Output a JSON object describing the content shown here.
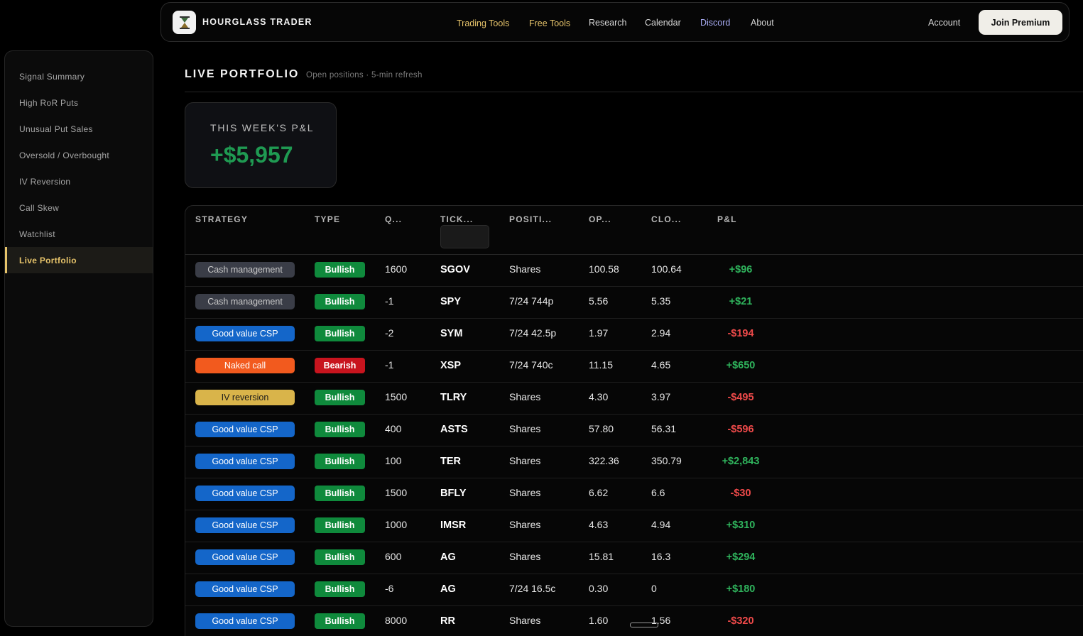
{
  "nav": {
    "brand": "HOURGLASS TRADER",
    "items": [
      "Trading Tools",
      "Free Tools",
      "Research",
      "Calendar",
      "Discord",
      "About"
    ],
    "account": "Account",
    "premium": "Join Premium"
  },
  "sidebar": {
    "items": [
      "Signal Summary",
      "High RoR Puts",
      "Unusual Put Sales",
      "Oversold / Overbought",
      "IV Reversion",
      "Call Skew",
      "Watchlist",
      "Live Portfolio"
    ],
    "active": "Live Portfolio"
  },
  "header": {
    "title": "LIVE PORTFOLIO",
    "subtitle": "Open positions · 5-min refresh"
  },
  "pnl_card": {
    "label": "THIS WEEK'S P&L",
    "value": "+$5,957"
  },
  "table": {
    "columns": [
      "STRATEGY",
      "TYPE",
      "Q...",
      "TICK...",
      "POSITI...",
      "OP...",
      "CLO...",
      "P&L"
    ],
    "rows": [
      {
        "strategy": "Cash management",
        "strategy_color": "#3a3d47",
        "type": "Bullish",
        "qty": "1600",
        "ticker": "SGOV",
        "position": "Shares",
        "open": "100.58",
        "close": "100.64",
        "pl": "+$96"
      },
      {
        "strategy": "Cash management",
        "strategy_color": "#3a3d47",
        "type": "Bullish",
        "qty": "-1",
        "ticker": "SPY",
        "position": "7/24 744p",
        "open": "5.56",
        "close": "5.35",
        "pl": "+$21"
      },
      {
        "strategy": "Good value CSP",
        "strategy_color": "#1466c9",
        "type": "Bullish",
        "qty": "-2",
        "ticker": "SYM",
        "position": "7/24 42.5p",
        "open": "1.97",
        "close": "2.94",
        "pl": "-$194"
      },
      {
        "strategy": "Naked call",
        "strategy_color": "#f25a1e",
        "type": "Bearish",
        "qty": "-1",
        "ticker": "XSP",
        "position": "7/24 740c",
        "open": "11.15",
        "close": "4.65",
        "pl": "+$650"
      },
      {
        "strategy": "IV reversion",
        "strategy_color": "#d9b44a",
        "type": "Bullish",
        "qty": "1500",
        "ticker": "TLRY",
        "position": "Shares",
        "open": "4.30",
        "close": "3.97",
        "pl": "-$495"
      },
      {
        "strategy": "Good value CSP",
        "strategy_color": "#1466c9",
        "type": "Bullish",
        "qty": "400",
        "ticker": "ASTS",
        "position": "Shares",
        "open": "57.80",
        "close": "56.31",
        "pl": "-$596"
      },
      {
        "strategy": "Good value CSP",
        "strategy_color": "#1466c9",
        "type": "Bullish",
        "qty": "100",
        "ticker": "TER",
        "position": "Shares",
        "open": "322.36",
        "close": "350.79",
        "pl": "+$2,843"
      },
      {
        "strategy": "Good value CSP",
        "strategy_color": "#1466c9",
        "type": "Bullish",
        "qty": "1500",
        "ticker": "BFLY",
        "position": "Shares",
        "open": "6.62",
        "close": "6.6",
        "pl": "-$30"
      },
      {
        "strategy": "Good value CSP",
        "strategy_color": "#1466c9",
        "type": "Bullish",
        "qty": "1000",
        "ticker": "IMSR",
        "position": "Shares",
        "open": "4.63",
        "close": "4.94",
        "pl": "+$310"
      },
      {
        "strategy": "Good value CSP",
        "strategy_color": "#1466c9",
        "type": "Bullish",
        "qty": "600",
        "ticker": "AG",
        "position": "Shares",
        "open": "15.81",
        "close": "16.3",
        "pl": "+$294"
      },
      {
        "strategy": "Good value CSP",
        "strategy_color": "#1466c9",
        "type": "Bullish",
        "qty": "-6",
        "ticker": "AG",
        "position": "7/24 16.5c",
        "open": "0.30",
        "close": "0",
        "pl": "+$180"
      },
      {
        "strategy": "Good value CSP",
        "strategy_color": "#1466c9",
        "type": "Bullish",
        "qty": "8000",
        "ticker": "RR",
        "position": "Shares",
        "open": "1.60",
        "close": "1.56",
        "pl": "-$320"
      }
    ]
  },
  "colors": {
    "bullish": "#0f8a3c",
    "bearish": "#c8141e",
    "gain": "#2fb35c",
    "loss": "#ef4a4a",
    "gold": "#e6c36a"
  }
}
